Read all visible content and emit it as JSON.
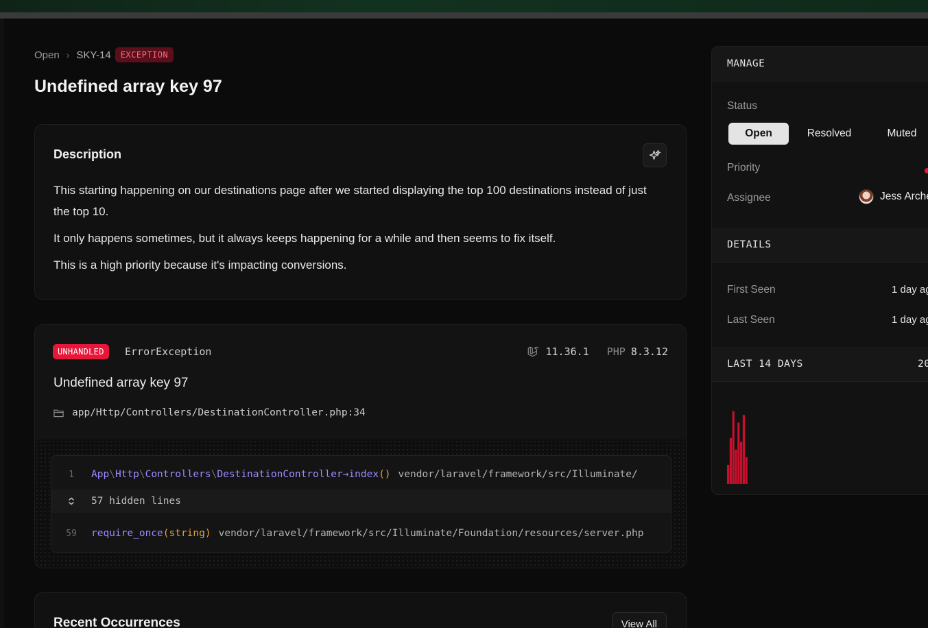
{
  "breadcrumb": {
    "root": "Open",
    "id": "SKY-14",
    "badge": "EXCEPTION"
  },
  "page": {
    "title": "Undefined array key 97"
  },
  "description": {
    "title": "Description",
    "paragraphs": [
      "This starting happening on our destinations page after we started displaying the top 100 destinations instead of just the top 10.",
      "It only happens sometimes, but it always keeps happening for a while and then seems to fix itself.",
      "This is a high priority because it's impacting conversions."
    ],
    "ai_button_icon": "sparkle-icon"
  },
  "exception": {
    "badge": "UNHANDLED",
    "class": "ErrorException",
    "laravel_version": "11.36.1",
    "php_label": "PHP",
    "php_version": "8.3.12",
    "message": "Undefined array key 97",
    "file": "app/Http/Controllers/DestinationController.php:34",
    "trace": {
      "frame1": {
        "line": "1",
        "ns1": "App",
        "ns2": "Http",
        "ns3": "Controllers",
        "ns4": "DestinationController",
        "arrow": "→",
        "method": "index",
        "parens": "()",
        "path": "vendor/laravel/framework/src/Illuminate/"
      },
      "hidden": "57 hidden lines",
      "frame2": {
        "line": "59",
        "func": "require_once",
        "args": "(string)",
        "path": "vendor/laravel/framework/src/Illuminate/Foundation/resources/server.php"
      }
    }
  },
  "occurrences": {
    "title": "Recent Occurrences",
    "view_all": "View All"
  },
  "sidebar": {
    "manage": {
      "heading": "MANAGE",
      "status_label": "Status",
      "status_options": [
        "Open",
        "Resolved",
        "Muted"
      ],
      "status_selected": "Open",
      "priority_label": "Priority",
      "priority_color": "#e8173a",
      "assignee_label": "Assignee",
      "assignee_name": "Jess Arche"
    },
    "details": {
      "heading": "DETAILS",
      "first_seen_label": "First Seen",
      "first_seen_value": "1 day ag",
      "last_seen_label": "Last Seen",
      "last_seen_value": "1 day ag"
    },
    "last14": {
      "heading": "LAST 14 DAYS",
      "count": "20",
      "bars": [
        0.25,
        0.6,
        0.95,
        0.45,
        0.8,
        0.55,
        0.9,
        0.35
      ],
      "bar_color": "#c8102e"
    }
  }
}
